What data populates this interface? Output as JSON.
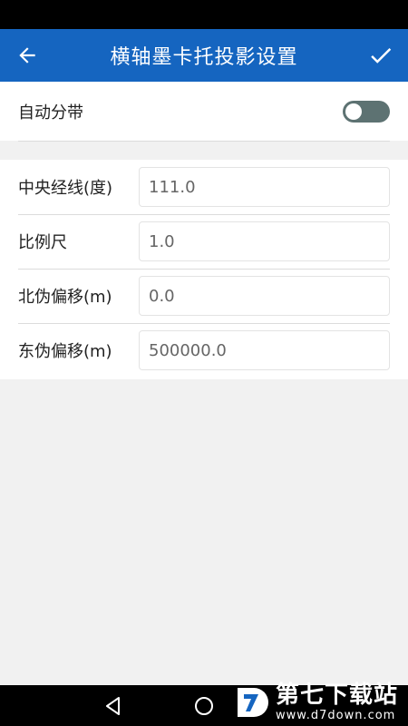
{
  "app_bar": {
    "title": "横轴墨卡托投影设置"
  },
  "auto_zone": {
    "label": "自动分带",
    "enabled": false
  },
  "params": [
    {
      "label": "中央经线(度)",
      "value": "111.0"
    },
    {
      "label": "比例尺",
      "value": "1.0"
    },
    {
      "label": "北伪偏移(m)",
      "value": "0.0"
    },
    {
      "label": "东伪偏移(m)",
      "value": "500000.0"
    }
  ],
  "watermark": {
    "title": "第七下载站",
    "url": "www.d7down.com"
  },
  "colors": {
    "primary": "#1565c0",
    "toggle_track": "#5d7272",
    "background": "#f1f1f1"
  }
}
